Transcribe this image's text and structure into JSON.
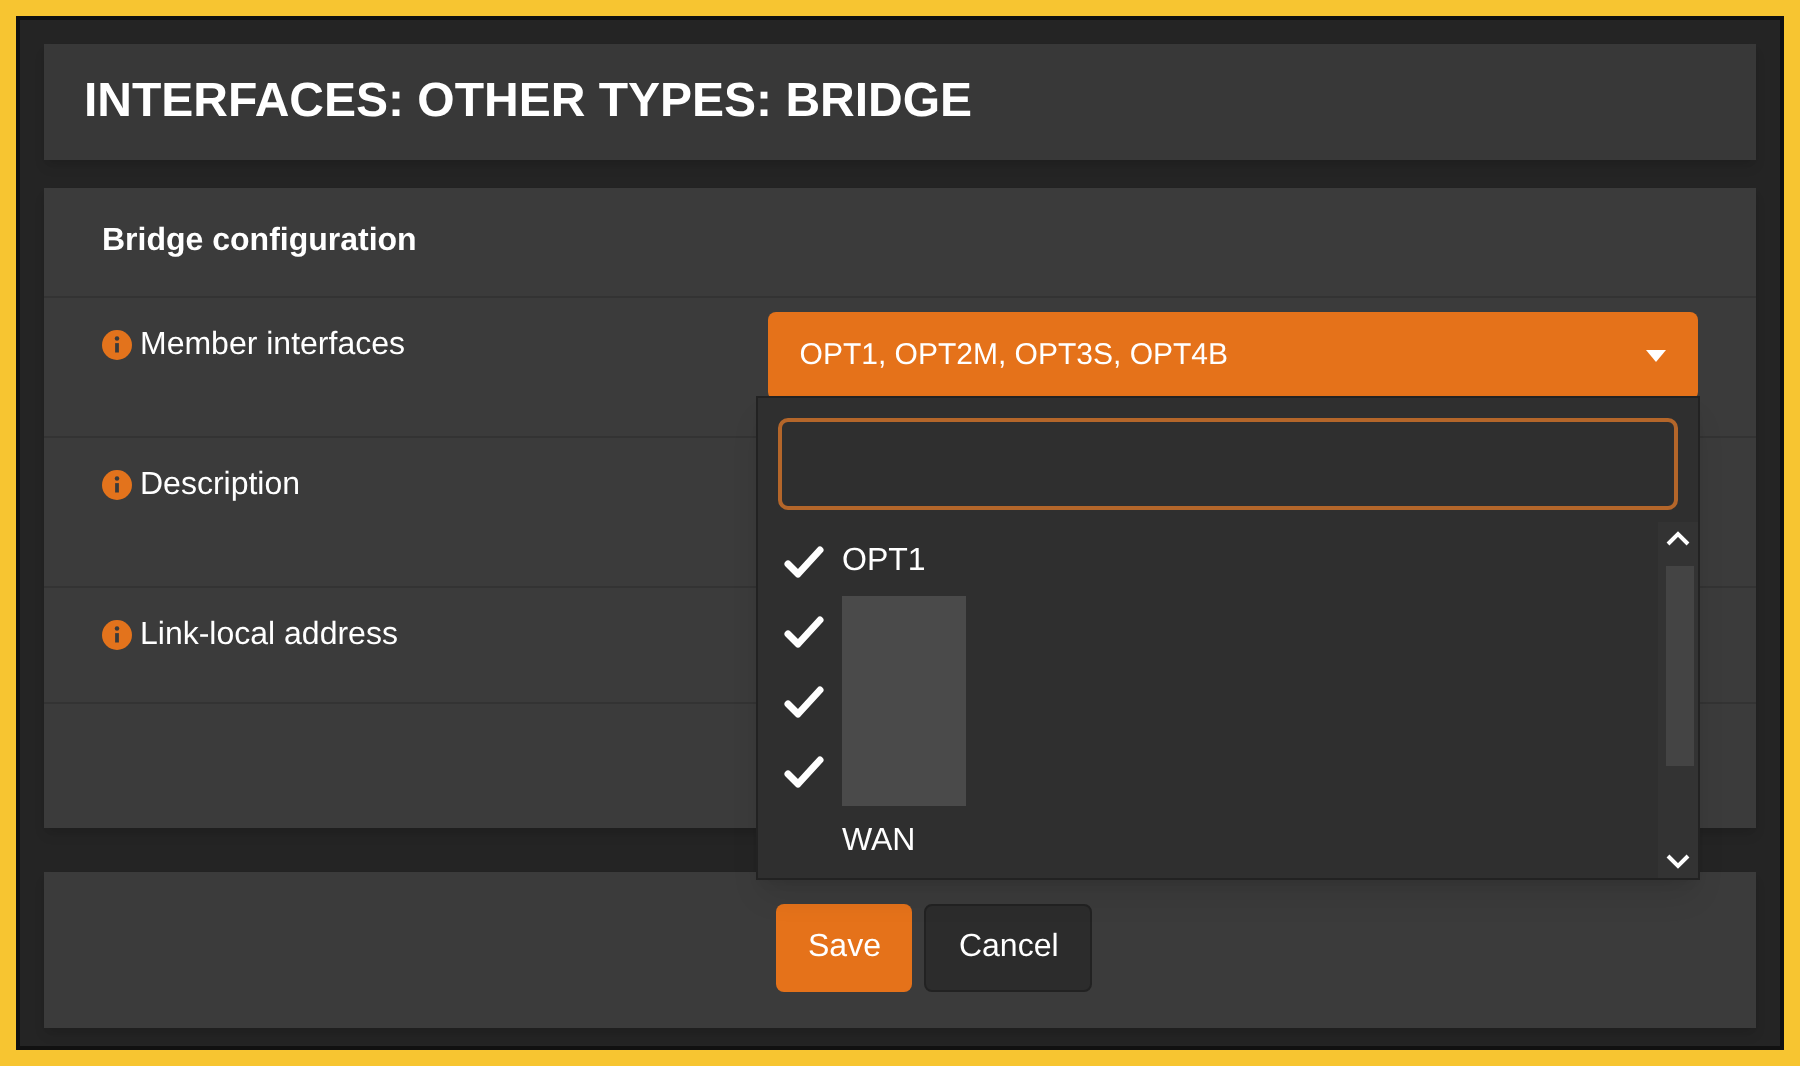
{
  "page_title": "INTERFACES: OTHER TYPES: BRIDGE",
  "section_title": "Bridge configuration",
  "fields": [
    {
      "label": "Member interfaces"
    },
    {
      "label": "Description"
    },
    {
      "label": "Link-local address"
    }
  ],
  "member_select": {
    "value": "OPT1, OPT2M, OPT3S, OPT4B",
    "expanded": true
  },
  "dropdown": {
    "options": [
      {
        "kind": "text",
        "label": "OPT1",
        "checked": true
      },
      {
        "kind": "redacted",
        "checked": true
      },
      {
        "kind": "redacted",
        "checked": true
      },
      {
        "kind": "redacted",
        "checked": true
      },
      {
        "kind": "text",
        "label": "WAN",
        "checked": false
      }
    ]
  },
  "buttons": [
    {
      "kind": "primary",
      "label": "Save"
    },
    {
      "kind": "secondary",
      "label": "Cancel"
    }
  ]
}
